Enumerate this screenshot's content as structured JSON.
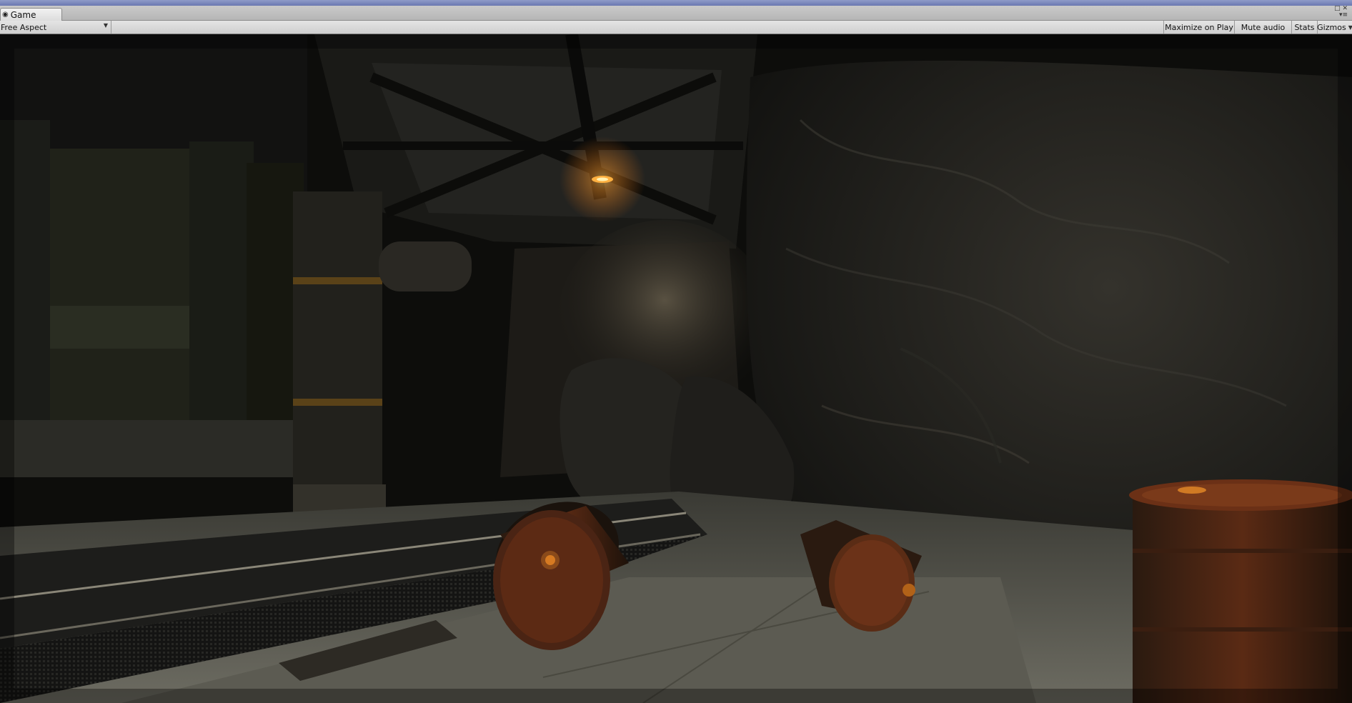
{
  "tab": {
    "title": "Game",
    "icon": "game-controller-icon"
  },
  "toolbar": {
    "aspect_label": "Free Aspect",
    "maximize_label": "Maximize on Play",
    "mute_label": "Mute audio",
    "stats_label": "Stats",
    "gizmos_label": "Gizmos"
  },
  "window_controls": {
    "maximize_icon": "maximize-icon",
    "close_icon": "close-icon",
    "menu_icon": "tab-menu-icon"
  },
  "colors": {
    "title_strip": "#7c88bd",
    "toolbar_bg": "#d8d8d8",
    "lamp_glow": "#ff9a2a",
    "barrel_rust": "#6b3018"
  }
}
